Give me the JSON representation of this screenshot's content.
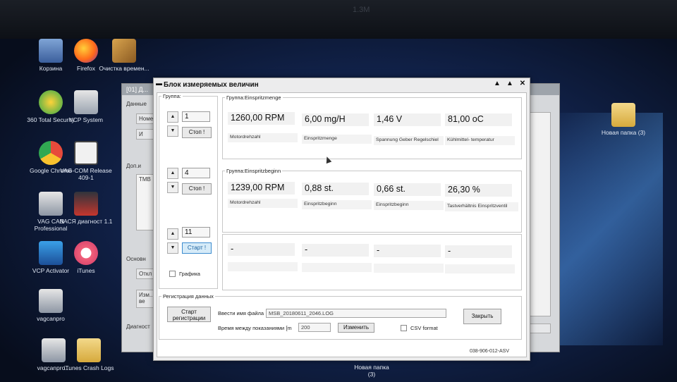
{
  "monitor": {
    "label": "1.3M"
  },
  "desktop_icons": [
    {
      "label": "Корзина",
      "icon": "recycle-bin-icon"
    },
    {
      "label": "Firefox",
      "icon": "firefox-icon"
    },
    {
      "label": "Очистка времен...",
      "icon": "broom-icon"
    },
    {
      "label": "360 Total Security",
      "icon": "shield-icon"
    },
    {
      "label": "VCP System",
      "icon": "vcp-icon"
    },
    {
      "label": "Google Chrome",
      "icon": "chrome-icon"
    },
    {
      "label": "VAG-COM Release 409-1",
      "icon": "vag-com-icon"
    },
    {
      "label": "VAG CAN Professional",
      "icon": "vag-can-icon"
    },
    {
      "label": "ВАСЯ диагност 1.1",
      "icon": "vasya-icon"
    },
    {
      "label": "VCP Activator",
      "icon": "vcp-activator-icon"
    },
    {
      "label": "iTunes",
      "icon": "itunes-icon"
    },
    {
      "label": "vagcanpro",
      "icon": "vagcanpro-icon"
    },
    {
      "label": "vagcanpro...",
      "icon": "vagcanpro-shortcut-icon"
    },
    {
      "label": "iTunes Crash Logs",
      "icon": "folder-icon"
    },
    {
      "label": "Новая папка (3)",
      "icon": "folder-icon"
    },
    {
      "label": "Новая папка (3)",
      "icon": "folder-icon"
    }
  ],
  "bg_dialog": {
    "title": "[01] Д...",
    "data_label": "Данные",
    "field1": "Номе",
    "field2": "И",
    "dop": "Доп.и",
    "tmb": "TMB",
    "osnov": "Основн",
    "btn_otkl": "Откл",
    "btn_izm": "Изм... ве",
    "diag": "Диагност"
  },
  "window": {
    "title": "Блок измеряемых величин",
    "groups_label": "Группа:",
    "rows": [
      {
        "number": "1",
        "button": "Стоп !",
        "active": false
      },
      {
        "number": "4",
        "button": "Стоп !",
        "active": false
      },
      {
        "number": "11",
        "button": "Старт !",
        "active": true
      }
    ],
    "graphics_label": "Графика",
    "group1": {
      "legend": "Группа:Einspritzmenge",
      "values": [
        "1260,00 RPM",
        "6,00 mg/H",
        "1,46 V",
        "81,00 oC"
      ],
      "labels": [
        "Motordrehzahl",
        "Einspritzmenge",
        "Spannung Geber Regelschiel",
        "Kühlmittel- temperatur"
      ]
    },
    "group2": {
      "legend": "Группа:Einspritzbeginn",
      "values": [
        "1239,00 RPM",
        "0,88 st.",
        "0,66 st.",
        "26,30 %"
      ],
      "labels": [
        "Motordrehzahl",
        "Einspritzbeginn",
        "Einspritzbeginn",
        "Tastverhältnis Einspritzventil"
      ]
    },
    "group3": {
      "values": [
        "-",
        "-",
        "-",
        "-"
      ],
      "labels": [
        "",
        "",
        "",
        ""
      ]
    },
    "registration": {
      "legend": "Регистрация данных",
      "start_button": "Старт регистрации",
      "filename_label": "Ввести имя файла",
      "filename_value": "MSB_20180611_2046.LOG",
      "interval_label": "Время между показаниями [m",
      "interval_value": "200",
      "change_button": "Изменить",
      "csv_label": "CSV format",
      "close_button": "Закрыть"
    },
    "footer_id": "038-906-012-ASV"
  },
  "taskbar_folder": "Новая папка (3)"
}
